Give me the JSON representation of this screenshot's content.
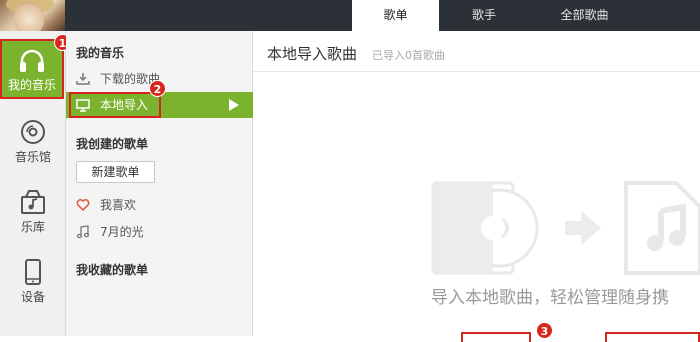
{
  "header": {
    "tabs": [
      {
        "label": "歌单",
        "active": true
      },
      {
        "label": "歌手",
        "active": false
      },
      {
        "label": "全部歌曲",
        "active": false
      }
    ]
  },
  "leftnav": {
    "items": [
      {
        "label": "我的音乐",
        "icon": "headphones-icon",
        "active": true
      },
      {
        "label": "音乐馆",
        "icon": "disc-icon",
        "active": false
      },
      {
        "label": "乐库",
        "icon": "music-box-icon",
        "active": false
      },
      {
        "label": "设备",
        "icon": "phone-icon",
        "active": false
      }
    ]
  },
  "subnav": {
    "my_music_title": "我的音乐",
    "downloaded": "下载的歌曲",
    "local_import": "本地导入",
    "created_title": "我创建的歌单",
    "new_playlist_button": "新建歌单",
    "favorites": "我喜欢",
    "playlist_july": "7月的光",
    "collected_title": "我收藏的歌单"
  },
  "main": {
    "title": "本地导入歌曲",
    "subtitle": "已导入0首歌曲",
    "empty_message": "导入本地歌曲，轻松管理随身携"
  },
  "badges": [
    "1",
    "2",
    "3"
  ],
  "colors": {
    "accent_green": "#7cb32e",
    "highlight_red": "#d4261f",
    "topbar_dark": "#2b3136"
  }
}
